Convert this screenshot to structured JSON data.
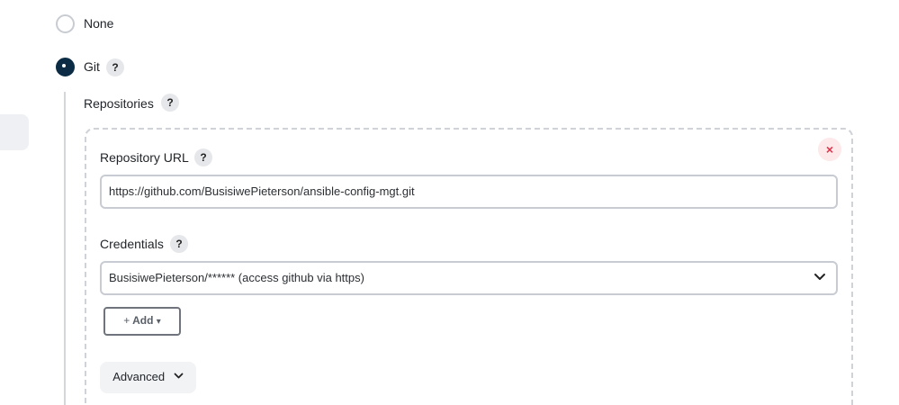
{
  "scm": {
    "options": [
      {
        "label": "None",
        "selected": false
      },
      {
        "label": "Git",
        "selected": true
      }
    ],
    "help_glyph": "?"
  },
  "git": {
    "repositories_label": "Repositories",
    "remove_glyph": "×",
    "repository_url_label": "Repository URL",
    "repository_url_value": "https://github.com/BusisiwePieterson/ansible-config-mgt.git",
    "credentials_label": "Credentials",
    "credentials_selected": "BusisiwePieterson/****** (access github via https)",
    "add_button_label": "Add",
    "add_button_prefix": "+",
    "add_button_caret": "▾",
    "advanced_button_label": "Advanced",
    "advanced_chevron": "⌄"
  }
}
